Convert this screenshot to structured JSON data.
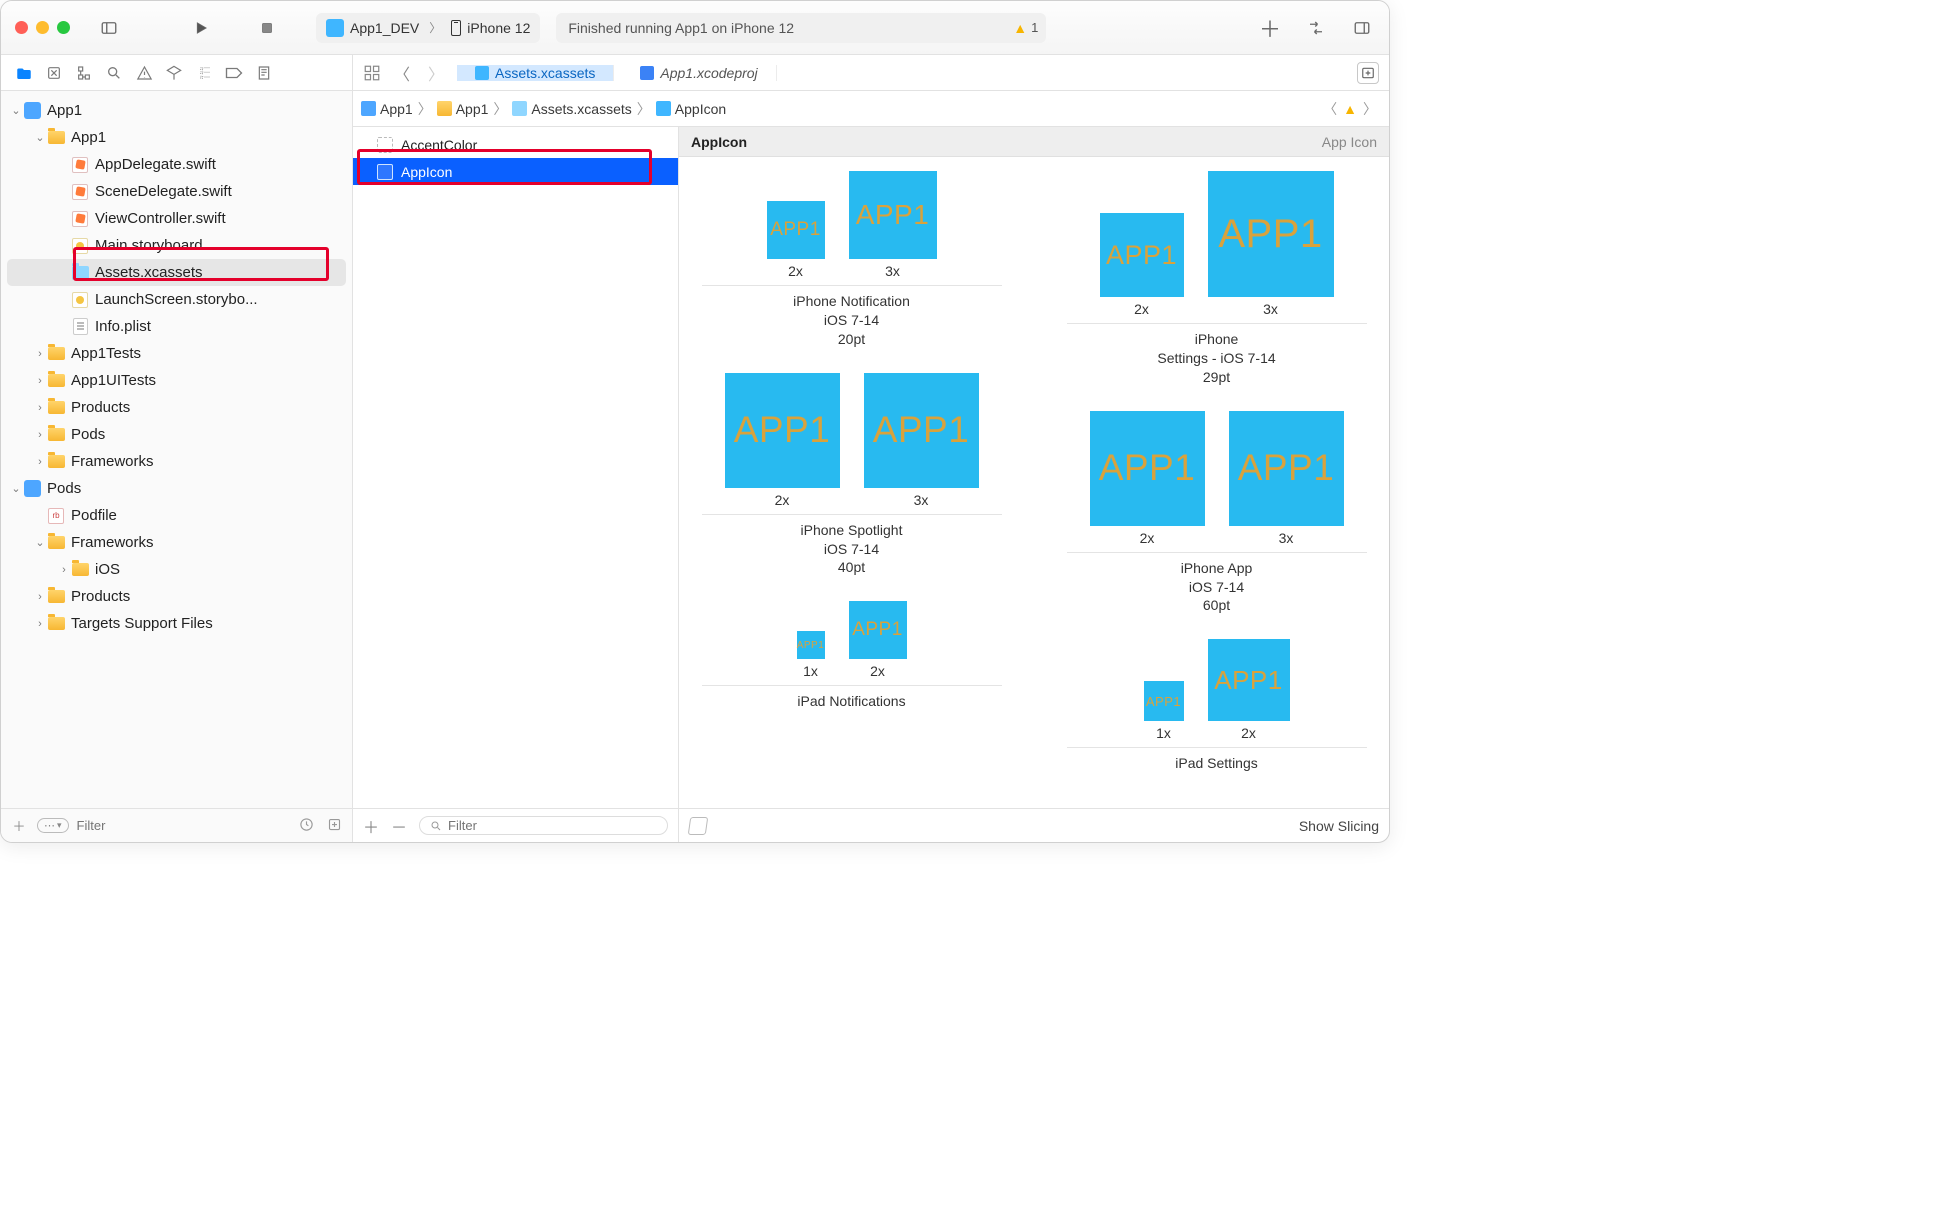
{
  "toolbar": {
    "scheme": "App1_DEV",
    "destination": "iPhone 12",
    "activity": "Finished running App1 on iPhone 12",
    "warning_count": "1"
  },
  "tabs": {
    "active": "Assets.xcassets",
    "secondary": "App1.xcodeproj"
  },
  "jumpbar": {
    "c0": "App1",
    "c1": "App1",
    "c2": "Assets.xcassets",
    "c3": "AppIcon"
  },
  "navigator": {
    "root": "App1",
    "items": [
      {
        "label": "App1"
      },
      {
        "label": "AppDelegate.swift"
      },
      {
        "label": "SceneDelegate.swift"
      },
      {
        "label": "ViewController.swift"
      },
      {
        "label": "Main.storyboard"
      },
      {
        "label": "Assets.xcassets"
      },
      {
        "label": "LaunchScreen.storybo..."
      },
      {
        "label": "Info.plist"
      },
      {
        "label": "App1Tests"
      },
      {
        "label": "App1UITests"
      },
      {
        "label": "Products"
      },
      {
        "label": "Pods"
      },
      {
        "label": "Frameworks"
      }
    ],
    "pods_root": "Pods",
    "pods_items": [
      {
        "label": "Podfile"
      },
      {
        "label": "Frameworks"
      },
      {
        "label": "iOS"
      },
      {
        "label": "Products"
      },
      {
        "label": "Targets Support Files"
      }
    ],
    "filter_placeholder": "Filter"
  },
  "asset_list": {
    "items": [
      {
        "label": "AccentColor"
      },
      {
        "label": "AppIcon"
      }
    ],
    "filter_placeholder": "Filter"
  },
  "asset_canvas": {
    "title": "AppIcon",
    "kind": "App Icon",
    "tile_text": "APP1",
    "groups": [
      {
        "slots": [
          {
            "scale": "2x",
            "size": 58
          },
          {
            "scale": "3x",
            "size": 88
          }
        ],
        "lines": [
          "iPhone Notification",
          "iOS 7-14",
          "20pt"
        ]
      },
      {
        "slots": [
          {
            "scale": "2x",
            "size": 84
          },
          {
            "scale": "3x",
            "size": 126
          }
        ],
        "lines": [
          "iPhone",
          "Settings - iOS 7-14",
          "29pt"
        ]
      },
      {
        "slots": [
          {
            "scale": "2x",
            "size": 115
          },
          {
            "scale": "3x",
            "size": 115
          }
        ],
        "lines": [
          "iPhone Spotlight",
          "iOS 7-14",
          "40pt"
        ]
      },
      {
        "slots": [
          {
            "scale": "2x",
            "size": 115
          },
          {
            "scale": "3x",
            "size": 115
          }
        ],
        "lines": [
          "iPhone App",
          "iOS 7-14",
          "60pt"
        ]
      },
      {
        "slots": [
          {
            "scale": "1x",
            "size": 28
          },
          {
            "scale": "2x",
            "size": 58
          }
        ],
        "lines": [
          "iPad Notifications"
        ]
      },
      {
        "slots": [
          {
            "scale": "1x",
            "size": 40
          },
          {
            "scale": "2x",
            "size": 82
          }
        ],
        "lines": [
          "iPad Settings"
        ]
      }
    ],
    "show_slicing": "Show Slicing"
  }
}
